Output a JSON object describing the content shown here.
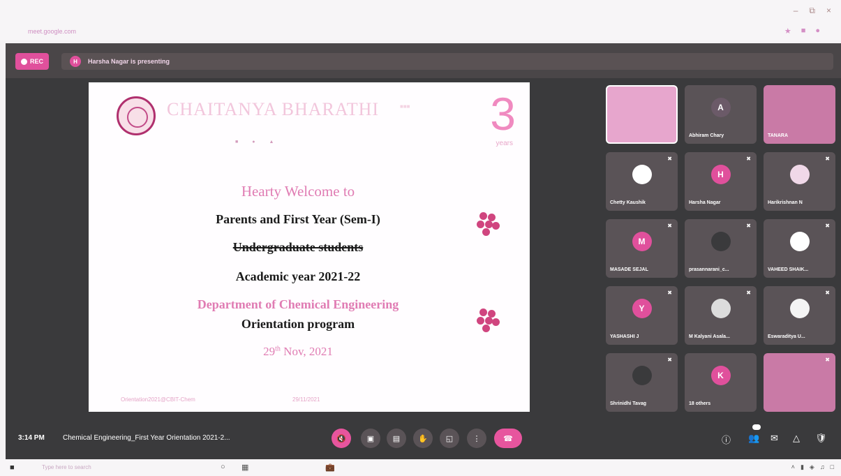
{
  "browser": {
    "tab_title": "",
    "url": "meet.google.com"
  },
  "meet": {
    "rec_label": "REC",
    "presenter_initial": "H",
    "presenting_text": "Harsha Nagar is presenting",
    "time": "3:14 PM",
    "meeting_name": "Chemical Engineering_First Year Orientation 2021-2..."
  },
  "slide": {
    "institution_title": "CHAITANYA BHARATHI",
    "institution_sub": "",
    "anniversary_number": "3",
    "anniversary_label": "years",
    "line1": "Hearty Welcome to",
    "line2": "Parents and First Year (Sem-I)",
    "line3": "Undergraduate students",
    "line4": "Academic year 2021-22",
    "line5": "Department of Chemical Engineering",
    "line6": "Orientation program",
    "line7_day": "29",
    "line7_suffix": "th",
    "line7_rest": " Nov, 2021",
    "footer_left": "Orientation2021@CBIT-Chem",
    "footer_right": "29/11/2021"
  },
  "participants": [
    {
      "name": "",
      "initial": "",
      "type": "video",
      "muted": false
    },
    {
      "name": "Abhiram Chary",
      "initial": "A",
      "type": "avatar",
      "color": "#6b5a68",
      "muted": false
    },
    {
      "name": "TANARA",
      "initial": "",
      "type": "video2",
      "muted": false
    },
    {
      "name": "Chetty Kaushik",
      "initial": "",
      "type": "avatar",
      "color": "#ffffff",
      "muted": true
    },
    {
      "name": "Harsha Nagar",
      "initial": "H",
      "type": "avatar",
      "color": "#e0509c",
      "muted": true
    },
    {
      "name": "Harikrishnan N",
      "initial": "",
      "type": "avatar",
      "color": "#f0d8e8",
      "muted": true
    },
    {
      "name": "MASADE SEJAL",
      "initial": "M",
      "type": "avatar",
      "color": "#e0509c",
      "muted": true
    },
    {
      "name": "prasannarani_c...",
      "initial": "",
      "type": "avatar",
      "color": "#3a3a3c",
      "muted": true
    },
    {
      "name": "VAHEED SHAIK...",
      "initial": "",
      "type": "avatar",
      "color": "#ffffff",
      "muted": true
    },
    {
      "name": "YASHASHI J",
      "initial": "Y",
      "type": "avatar",
      "color": "#e0509c",
      "muted": true
    },
    {
      "name": "M Kalyani Asala...",
      "initial": "",
      "type": "avatar",
      "color": "#dcdcdc",
      "muted": true
    },
    {
      "name": "Eswaraditya U...",
      "initial": "",
      "type": "avatar",
      "color": "#f4f4f4",
      "muted": true
    },
    {
      "name": "Shrinidhi Tavag",
      "initial": "",
      "type": "avatar",
      "color": "#3a3a3c",
      "muted": true
    },
    {
      "name": "18 others",
      "initial": "K",
      "type": "avatar",
      "color": "#e0509c",
      "muted": false
    },
    {
      "name": "",
      "initial": "",
      "type": "video2",
      "muted": true
    }
  ],
  "colors": {
    "accent": "#e0509c",
    "meet_bg": "#3a3a3c",
    "slide_pink": "#e07cb3"
  },
  "taskbar": {
    "search_placeholder": "Type here to search"
  }
}
